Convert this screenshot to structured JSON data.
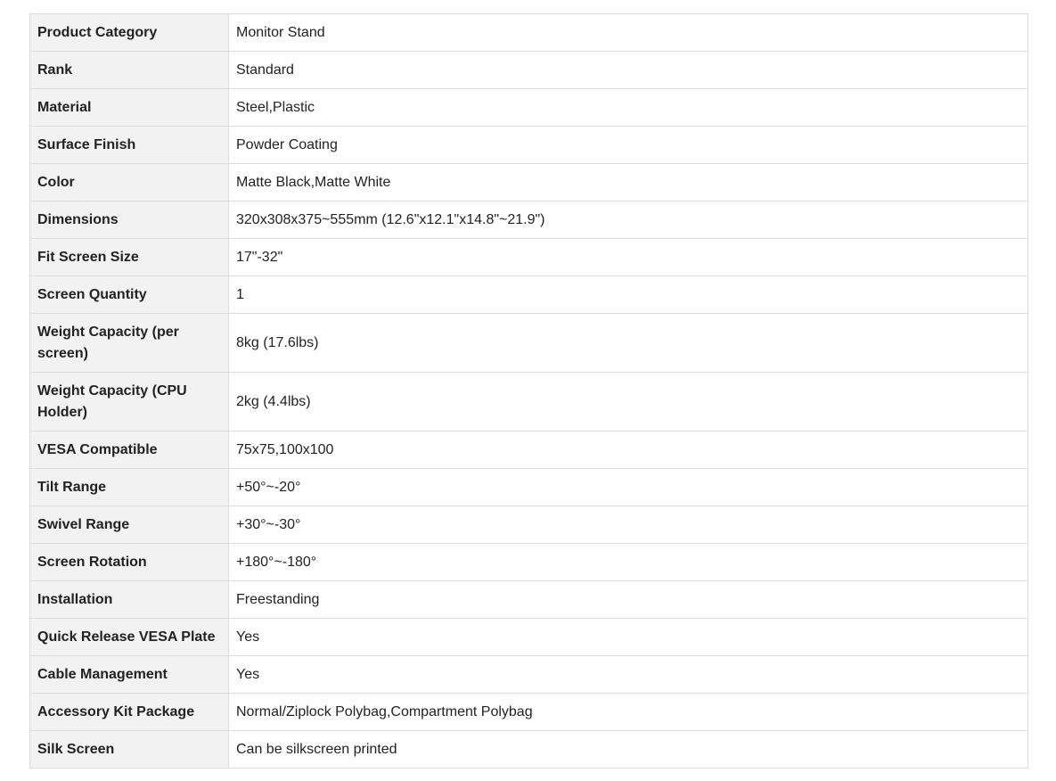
{
  "specs": {
    "rows": [
      {
        "label": "Product Category",
        "value": "Monitor Stand"
      },
      {
        "label": "Rank",
        "value": "Standard"
      },
      {
        "label": "Material",
        "value": "Steel,Plastic"
      },
      {
        "label": "Surface Finish",
        "value": "Powder Coating"
      },
      {
        "label": "Color",
        "value": "Matte Black,Matte White"
      },
      {
        "label": "Dimensions",
        "value": "320x308x375~555mm (12.6\"x12.1\"x14.8\"~21.9\")"
      },
      {
        "label": "Fit Screen Size",
        "value": "17\"-32\""
      },
      {
        "label": "Screen Quantity",
        "value": "1"
      },
      {
        "label": "Weight Capacity (per screen)",
        "value": "8kg (17.6lbs)"
      },
      {
        "label": "Weight Capacity (CPU Holder)",
        "value": "2kg (4.4lbs)"
      },
      {
        "label": "VESA Compatible",
        "value": "75x75,100x100"
      },
      {
        "label": "Tilt Range",
        "value": "+50°~-20°"
      },
      {
        "label": "Swivel Range",
        "value": "+30°~-30°"
      },
      {
        "label": "Screen Rotation",
        "value": "+180°~-180°"
      },
      {
        "label": "Installation",
        "value": "Freestanding"
      },
      {
        "label": "Quick Release VESA Plate",
        "value": "Yes"
      },
      {
        "label": "Cable Management",
        "value": "Yes"
      },
      {
        "label": "Accessory Kit Package",
        "value": "Normal/Ziplock Polybag,Compartment Polybag"
      },
      {
        "label": "Silk Screen",
        "value": "Can be silkscreen printed"
      }
    ]
  }
}
